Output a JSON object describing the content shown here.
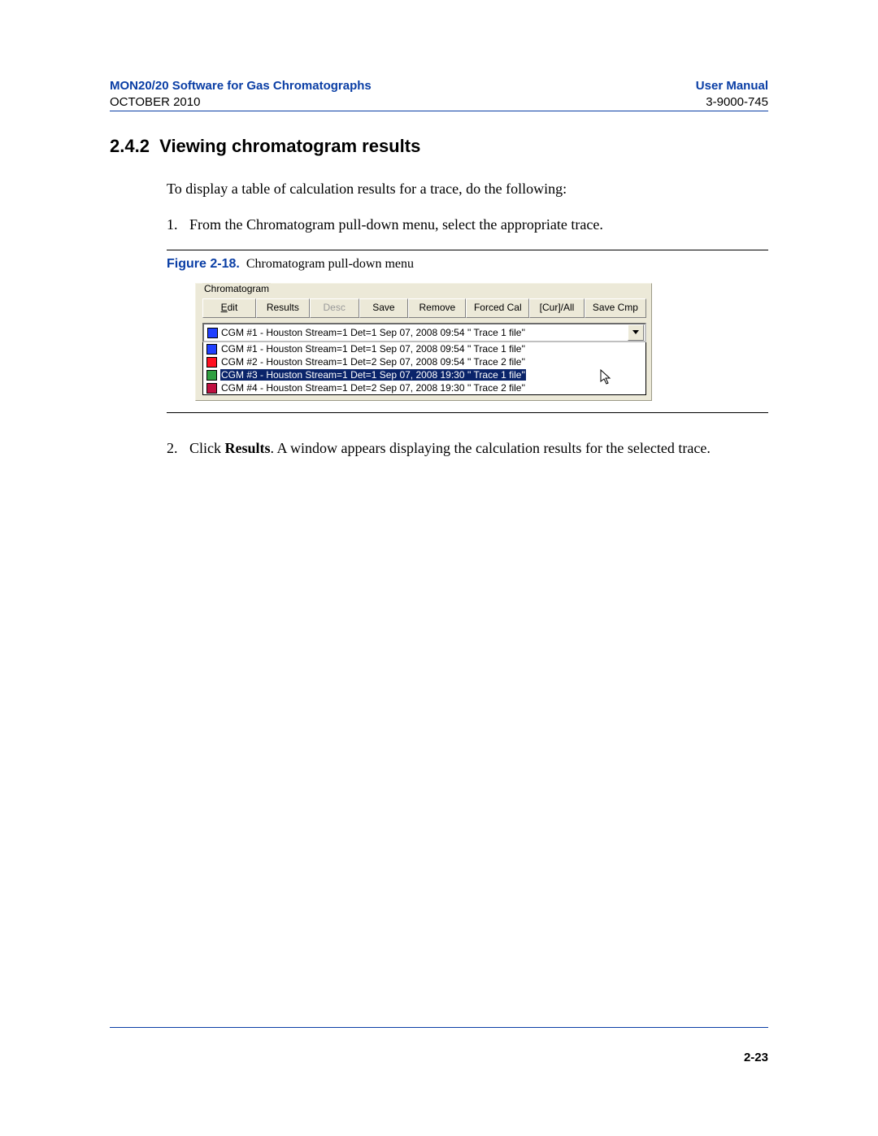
{
  "header": {
    "left_title": "MON20/20 Software for Gas Chromatographs",
    "right_title": "User Manual",
    "left_sub": "OCTOBER 2010",
    "right_sub": "3-9000-745"
  },
  "section": {
    "number": "2.4.2",
    "title": "Viewing chromatogram results"
  },
  "intro": "To display a table of calculation results for a trace, do the following:",
  "step1": {
    "num": "1.",
    "text": "From the Chromatogram pull-down menu, select the appropriate trace."
  },
  "figure": {
    "label": "Figure 2-18.",
    "caption": "Chromatogram pull-down menu"
  },
  "ui": {
    "group_label": "Chromatogram",
    "buttons": {
      "edit": "Edit",
      "results": "Results",
      "desc": "Desc",
      "save": "Save",
      "remove": "Remove",
      "forced_cal": "Forced Cal",
      "cur_all": "[Cur]/All",
      "save_cmp": "Save Cmp"
    },
    "combo_selected": "CGM #1 - Houston Stream=1 Det=1 Sep 07, 2008 09:54 '' Trace 1 file''",
    "dropdown": [
      {
        "color": "#2040ff",
        "text": "CGM #1 - Houston Stream=1 Det=1 Sep 07, 2008 09:54 '' Trace 1 file''",
        "selected": false
      },
      {
        "color": "#ff1020",
        "text": "CGM #2 - Houston Stream=1 Det=2 Sep 07, 2008 09:54 '' Trace 2 file''",
        "selected": false
      },
      {
        "color": "#30a040",
        "text": "CGM #3 - Houston Stream=1 Det=1 Sep 07, 2008 19:30 '' Trace 1 file''",
        "selected": true
      },
      {
        "color": "#c01040",
        "text": "CGM #4 - Houston Stream=1 Det=2 Sep 07, 2008 19:30 '' Trace 2 file''",
        "selected": false
      }
    ]
  },
  "step2": {
    "num": "2.",
    "pre": "Click ",
    "bold": "Results",
    "post": ". A window appears displaying the calculation results for the selected trace."
  },
  "page_number": "2-23"
}
